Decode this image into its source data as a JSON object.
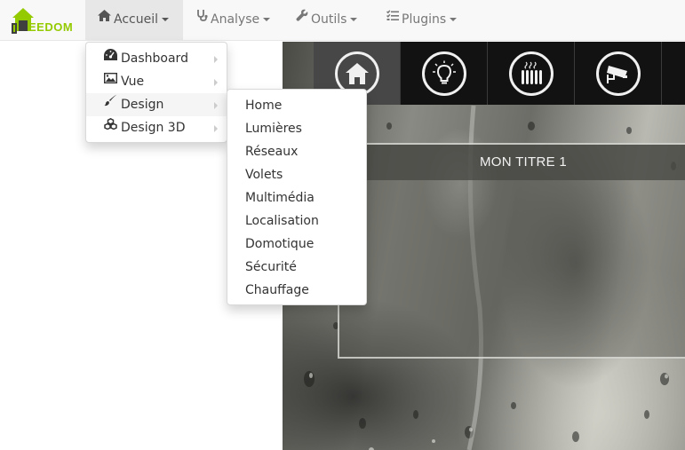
{
  "app": {
    "logo_text": "EEDOM"
  },
  "navbar": {
    "items": [
      {
        "label": "Accueil",
        "icon": "home-icon"
      },
      {
        "label": "Analyse",
        "icon": "stethoscope-icon"
      },
      {
        "label": "Outils",
        "icon": "wrench-icon"
      },
      {
        "label": "Plugins",
        "icon": "tasks-icon"
      }
    ]
  },
  "accueil_menu": {
    "items": [
      {
        "label": "Dashboard",
        "icon": "dashboard-icon"
      },
      {
        "label": "Vue",
        "icon": "picture-icon"
      },
      {
        "label": "Design",
        "icon": "paintbrush-icon"
      },
      {
        "label": "Design 3D",
        "icon": "cubes-icon"
      }
    ]
  },
  "design_menu": {
    "items": [
      "Home",
      "Lumières",
      "Réseaux",
      "Volets",
      "Multimédia",
      "Localisation",
      "Domotique",
      "Sécurité",
      "Chauffage"
    ]
  },
  "design_view": {
    "title": "MON TITRE 1",
    "tiles": [
      "home-icon",
      "lightbulb-icon",
      "radiator-icon",
      "camera-icon"
    ]
  },
  "colors": {
    "brand": "#94ca02",
    "tile_bar": "#121212"
  }
}
